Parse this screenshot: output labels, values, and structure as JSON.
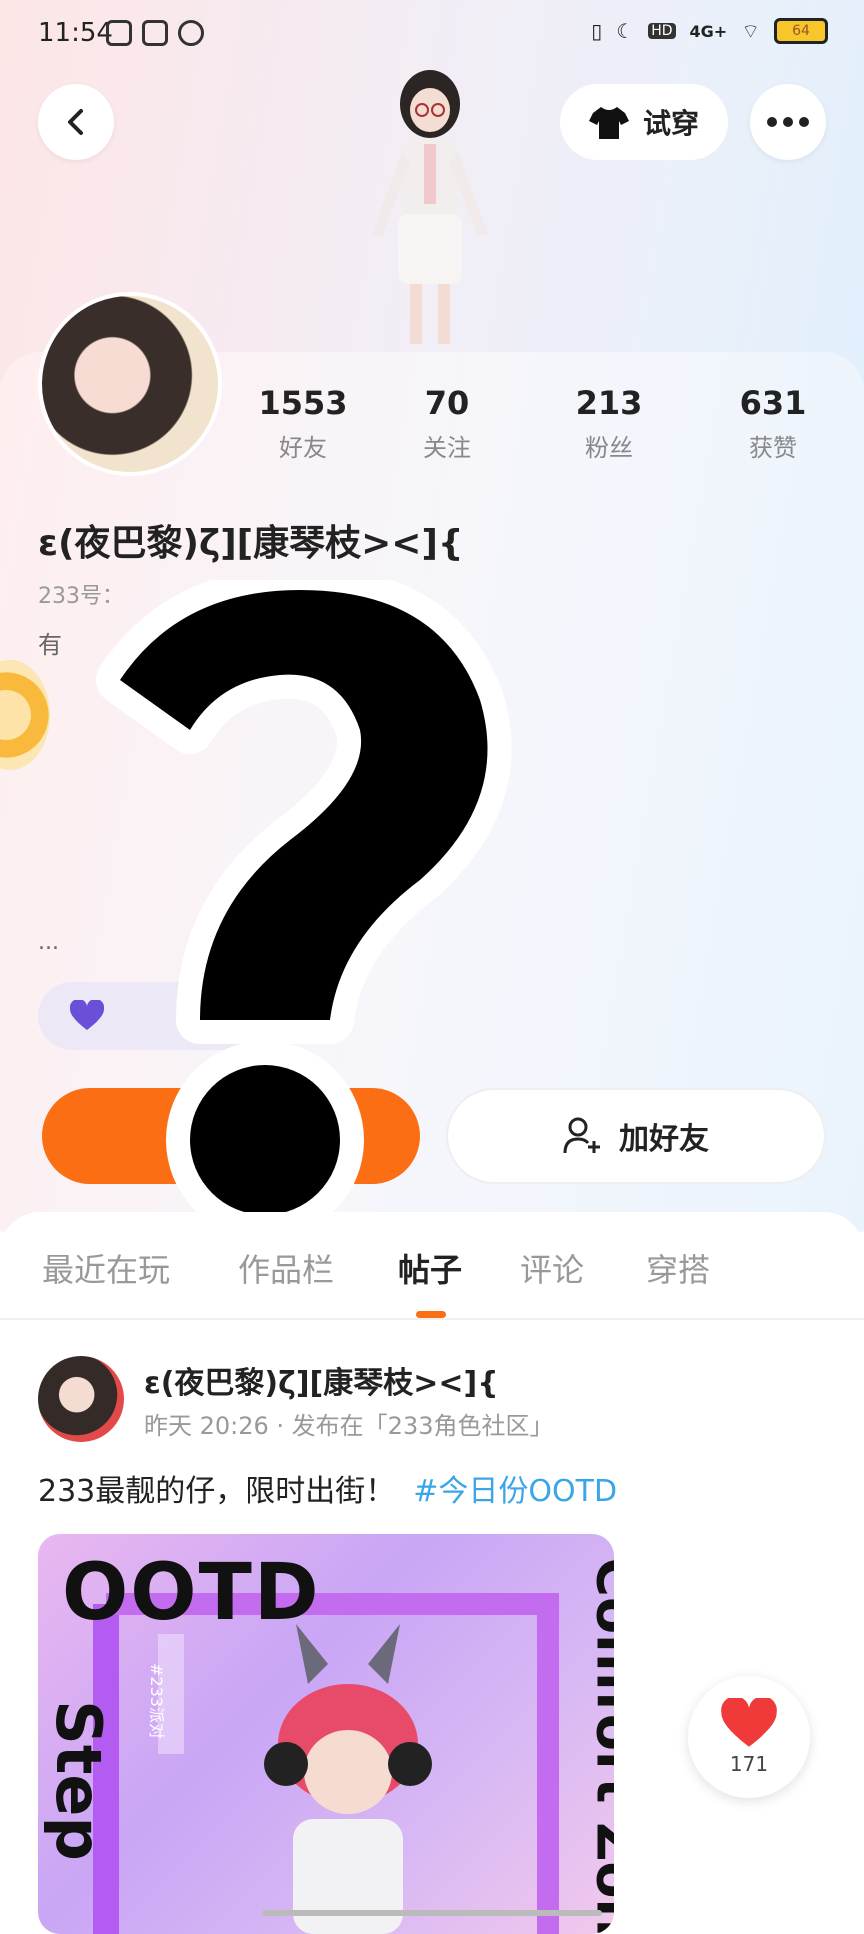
{
  "status_bar": {
    "time": "11:54",
    "signal_label": "4G+",
    "hd_label": "HD",
    "battery": "64"
  },
  "header": {
    "back_icon": "chevron-left-icon",
    "try_on_label": "试穿",
    "more_icon": "more-dots-icon"
  },
  "profile": {
    "stats": [
      {
        "value": "1553",
        "label": "好友"
      },
      {
        "value": "70",
        "label": "关注"
      },
      {
        "value": "213",
        "label": "粉丝"
      },
      {
        "value": "631",
        "label": "获赞"
      }
    ],
    "nickname": "ε(夜巴黎)ζ][康琴枝><]{",
    "uid_prefix": "233号：",
    "bio_prefix": "有",
    "more_dots": "...",
    "add_friend_label": "加好友"
  },
  "tabs": [
    {
      "label": "最近在玩"
    },
    {
      "label": "作品栏"
    },
    {
      "label": "帖子"
    },
    {
      "label": "评论"
    },
    {
      "label": "穿搭"
    }
  ],
  "post": {
    "author": "ε(夜巴黎)ζ][康琴枝><]{",
    "meta": "昨天 20:26 · 发布在「233角色社区」",
    "text": "233最靓的仔，限时出街！",
    "hashtag": "#今日份OOTD",
    "image_texts": {
      "title": "OOTD",
      "left_word": "Step",
      "right_word": "Comfort Zone",
      "tag": "#233派对"
    },
    "like_count": "171"
  },
  "colors": {
    "accent": "#fb6e14",
    "hashtag": "#3ba5e8",
    "like": "#f03a3a"
  }
}
